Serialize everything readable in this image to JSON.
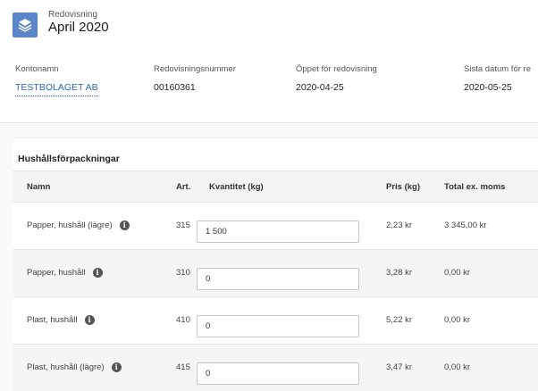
{
  "header": {
    "subtitle": "Redovisning",
    "title": "April 2020",
    "fields": [
      {
        "label": "Kontonamn",
        "value": "TESTBOLAGET AB"
      },
      {
        "label": "Redovisningsnummer",
        "value": "00160361"
      },
      {
        "label": "Öppet för redovisning",
        "value": "2020-04-25"
      },
      {
        "label": "Sista datum för re",
        "value": "2020-05-25"
      }
    ]
  },
  "section": {
    "title": "Hushållsförpackningar",
    "columns": {
      "name": "Namn",
      "art": "Art.",
      "qty": "Kvantitet (kg)",
      "price": "Pris (kg)",
      "total": "Total ex. moms"
    },
    "rows": [
      {
        "name": "Papper, hushåll (lägre)",
        "art": "315",
        "qty": "1 500",
        "price": "2,23 kr",
        "total": "3 345,00 kr"
      },
      {
        "name": "Papper, hushåll",
        "art": "310",
        "qty": "0",
        "price": "3,28 kr",
        "total": "0,00 kr"
      },
      {
        "name": "Plast, hushåll",
        "art": "410",
        "qty": "0",
        "price": "5,22 kr",
        "total": "0,00 kr"
      },
      {
        "name": "Plast, hushåll (lägre)",
        "art": "415",
        "qty": "0",
        "price": "3,47 kr",
        "total": "0,00 kr"
      }
    ],
    "info_icon": "i"
  },
  "colors": {
    "logo": "#5b86c8",
    "link": "#2b67b8"
  }
}
